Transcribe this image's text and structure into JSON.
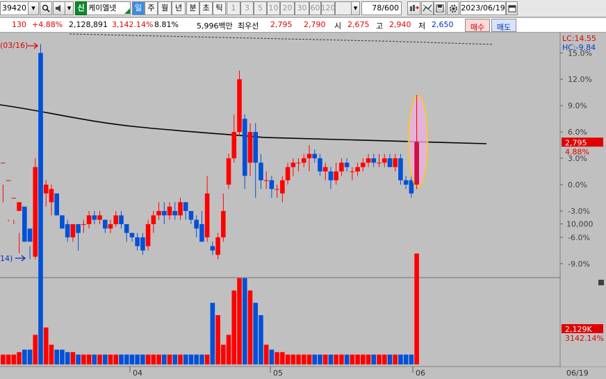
{
  "toolbar": {
    "stock_code": "39420",
    "stock_badge": "신",
    "stock_name": "케이엘넷",
    "periods": [
      "일",
      "주",
      "월",
      "년",
      "분",
      "초",
      "틱"
    ],
    "intervals": [
      "1",
      "3",
      "5",
      "10",
      "20",
      "30",
      "60",
      "120"
    ],
    "count": "78/600",
    "date": "2023/06/19"
  },
  "info": {
    "change": "130",
    "change_pct": "+4.88%",
    "volume": "2,128,891",
    "volume_pct": "3,142.14%",
    "turnover_pct": "8.81%",
    "amount": "5,996백만",
    "label_best": "최우선",
    "ask": "2,795",
    "bid": "2,790",
    "label_open": "시",
    "open": "2,675",
    "label_high": "고",
    "high": "2,940",
    "label_low": "저",
    "low": "2,650",
    "buy_label": "매수",
    "sell_label": "매도"
  },
  "chart_data": {
    "type": "candlestick",
    "price_yaxis": {
      "unit": "%",
      "ticks": [
        "15.0%",
        "12.0%",
        "9.0%",
        "6.0%",
        "3.0%",
        "0.0%",
        "-3.0%",
        "-6.0%",
        "-9.0%"
      ]
    },
    "volume_yaxis": {
      "ticks": [
        "10,000"
      ]
    },
    "xaxis": {
      "ticks": [
        "04",
        "05",
        "06"
      ],
      "end_label": "06/19"
    },
    "lc_label": "LC:14.55",
    "hc_label": "HC:-9.84",
    "current_price": "2,795",
    "current_pct": "4.88%",
    "current_volume": "2,129K",
    "current_volume_pct": "3142.14%",
    "high_marker": "(03/16)",
    "low_marker": "14)",
    "up_color": "#ff0000",
    "down_color": "#0050d8",
    "candles": [
      [
        2.5,
        2.5,
        -2.0,
        0.0
      ],
      [
        0.5,
        0.5,
        -4.2,
        -4.0
      ],
      [
        -1.5,
        -1.5,
        -4.5,
        -4.0
      ],
      [
        -3.0,
        -2.0,
        -7.8,
        -5.5
      ],
      [
        -2.5,
        -6.5,
        -7.5,
        -7.5
      ],
      [
        -5.0,
        -6.5,
        -7.0,
        -8.5
      ],
      [
        -8.2,
        2.0,
        -8.5,
        3.0
      ],
      [
        15.0,
        -2.0,
        -2.0,
        16.0
      ],
      [
        -1.0,
        0.0,
        -2.5,
        0.5
      ],
      [
        -2.0,
        -0.5,
        -3.5,
        0.0
      ],
      [
        -1.0,
        -3.5,
        -3.5,
        -1.0
      ],
      [
        -3.5,
        -5.0,
        -5.0,
        -3.5
      ],
      [
        -4.5,
        -6.0,
        -6.5,
        -4.0
      ],
      [
        -6.0,
        -4.5,
        -6.5,
        -4.5
      ],
      [
        -4.5,
        -5.5,
        -7.5,
        -4.5
      ],
      [
        -4.5,
        -4.5,
        -5.5,
        -4.0
      ],
      [
        -4.5,
        -3.5,
        -5.0,
        -3.0
      ],
      [
        -3.5,
        -4.0,
        -4.5,
        -3.0
      ],
      [
        -4.0,
        -3.5,
        -4.5,
        -3.0
      ],
      [
        -4.0,
        -5.0,
        -5.5,
        -4.0
      ],
      [
        -5.0,
        -4.5,
        -5.5,
        -4.0
      ],
      [
        -4.5,
        -3.5,
        -4.8,
        -3.0
      ],
      [
        -3.5,
        -4.5,
        -5.0,
        -3.0
      ],
      [
        -4.5,
        -5.5,
        -6.5,
        -4.5
      ],
      [
        -5.5,
        -6.0,
        -6.5,
        -5.5
      ],
      [
        -6.0,
        -7.0,
        -7.5,
        -5.5
      ],
      [
        -6.0,
        -7.5,
        -8.0,
        -5.5
      ],
      [
        -7.0,
        -4.5,
        -7.5,
        -4.0
      ],
      [
        -4.5,
        -3.5,
        -5.5,
        -3.0
      ],
      [
        -3.5,
        -3.0,
        -4.0,
        -2.0
      ],
      [
        -3.0,
        -3.5,
        -4.5,
        -2.0
      ],
      [
        -3.5,
        -2.5,
        -4.0,
        -2.0
      ],
      [
        -3.0,
        -3.5,
        -4.0,
        -2.0
      ],
      [
        -3.5,
        -2.0,
        -4.0,
        -1.5
      ],
      [
        -2.0,
        -3.0,
        -4.0,
        -2.0
      ],
      [
        -3.0,
        -4.0,
        -4.5,
        -3.0
      ],
      [
        -4.0,
        -5.0,
        -6.0,
        -3.5
      ],
      [
        -4.5,
        -6.5,
        -6.5,
        -3.0
      ],
      [
        -6.0,
        -1.0,
        -6.5,
        1.0
      ],
      [
        -7.0,
        -7.5,
        -8.0,
        -6.5
      ],
      [
        -8.0,
        -6.0,
        -8.5,
        -5.5
      ],
      [
        -6.0,
        -3.0,
        -6.5,
        -1.0
      ],
      [
        0.0,
        3.0,
        -0.5,
        3.5
      ],
      [
        3.0,
        6.0,
        2.5,
        8.0
      ],
      [
        6.0,
        12.0,
        5.5,
        13.0
      ],
      [
        7.5,
        1.0,
        -0.5,
        8.0
      ],
      [
        2.5,
        6.0,
        1.0,
        7.0
      ],
      [
        6.0,
        2.5,
        -1.5,
        7.0
      ],
      [
        2.5,
        0.5,
        -0.5,
        3.5
      ],
      [
        0.5,
        0.5,
        -0.5,
        1.5
      ],
      [
        0.5,
        -0.5,
        -1.5,
        1.0
      ],
      [
        -0.5,
        -0.5,
        -1.5,
        0.0
      ],
      [
        -1.0,
        0.5,
        -2.0,
        1.0
      ],
      [
        0.5,
        2.0,
        0.0,
        2.5
      ],
      [
        2.0,
        2.5,
        1.0,
        3.0
      ],
      [
        2.5,
        2.5,
        1.5,
        3.0
      ],
      [
        2.5,
        3.0,
        2.0,
        3.5
      ],
      [
        3.0,
        3.5,
        1.5,
        4.5
      ],
      [
        3.5,
        3.0,
        2.5,
        4.0
      ],
      [
        3.0,
        1.5,
        1.0,
        3.5
      ],
      [
        1.5,
        2.0,
        0.5,
        2.5
      ],
      [
        1.5,
        0.5,
        -0.5,
        2.0
      ],
      [
        0.5,
        1.5,
        0.0,
        2.5
      ],
      [
        1.5,
        2.5,
        1.0,
        3.0
      ],
      [
        2.5,
        2.0,
        1.5,
        3.0
      ],
      [
        1.5,
        1.5,
        0.5,
        2.0
      ],
      [
        1.5,
        2.0,
        1.0,
        2.5
      ],
      [
        2.0,
        2.5,
        1.5,
        3.0
      ],
      [
        2.5,
        3.0,
        2.0,
        3.5
      ],
      [
        3.0,
        2.5,
        2.0,
        3.5
      ],
      [
        2.5,
        2.5,
        2.0,
        3.5
      ],
      [
        2.5,
        3.0,
        2.0,
        3.5
      ],
      [
        3.0,
        2.0,
        2.0,
        3.5
      ],
      [
        2.0,
        3.0,
        1.5,
        3.5
      ],
      [
        3.0,
        0.5,
        0.0,
        3.5
      ],
      [
        0.5,
        0.0,
        -0.5,
        1.0
      ],
      [
        0.5,
        -1.0,
        -1.5,
        1.5
      ],
      [
        0.0,
        4.88,
        -0.5,
        10.2
      ]
    ],
    "volumes": [
      4,
      4,
      4,
      5,
      6,
      6,
      12,
      100,
      15,
      8,
      6,
      6,
      5,
      5,
      4,
      4,
      4,
      4,
      4,
      4,
      4,
      4,
      4,
      4,
      4,
      4,
      4,
      4,
      4,
      4,
      4,
      4,
      4,
      4,
      4,
      4,
      4,
      4,
      4,
      25,
      20,
      8,
      12,
      30,
      35,
      35,
      30,
      25,
      20,
      8,
      6,
      5,
      5,
      4,
      4,
      4,
      4,
      4,
      4,
      4,
      4,
      4,
      4,
      4,
      4,
      4,
      4,
      4,
      4,
      4,
      4,
      4,
      4,
      4,
      4,
      4,
      4,
      45
    ]
  }
}
